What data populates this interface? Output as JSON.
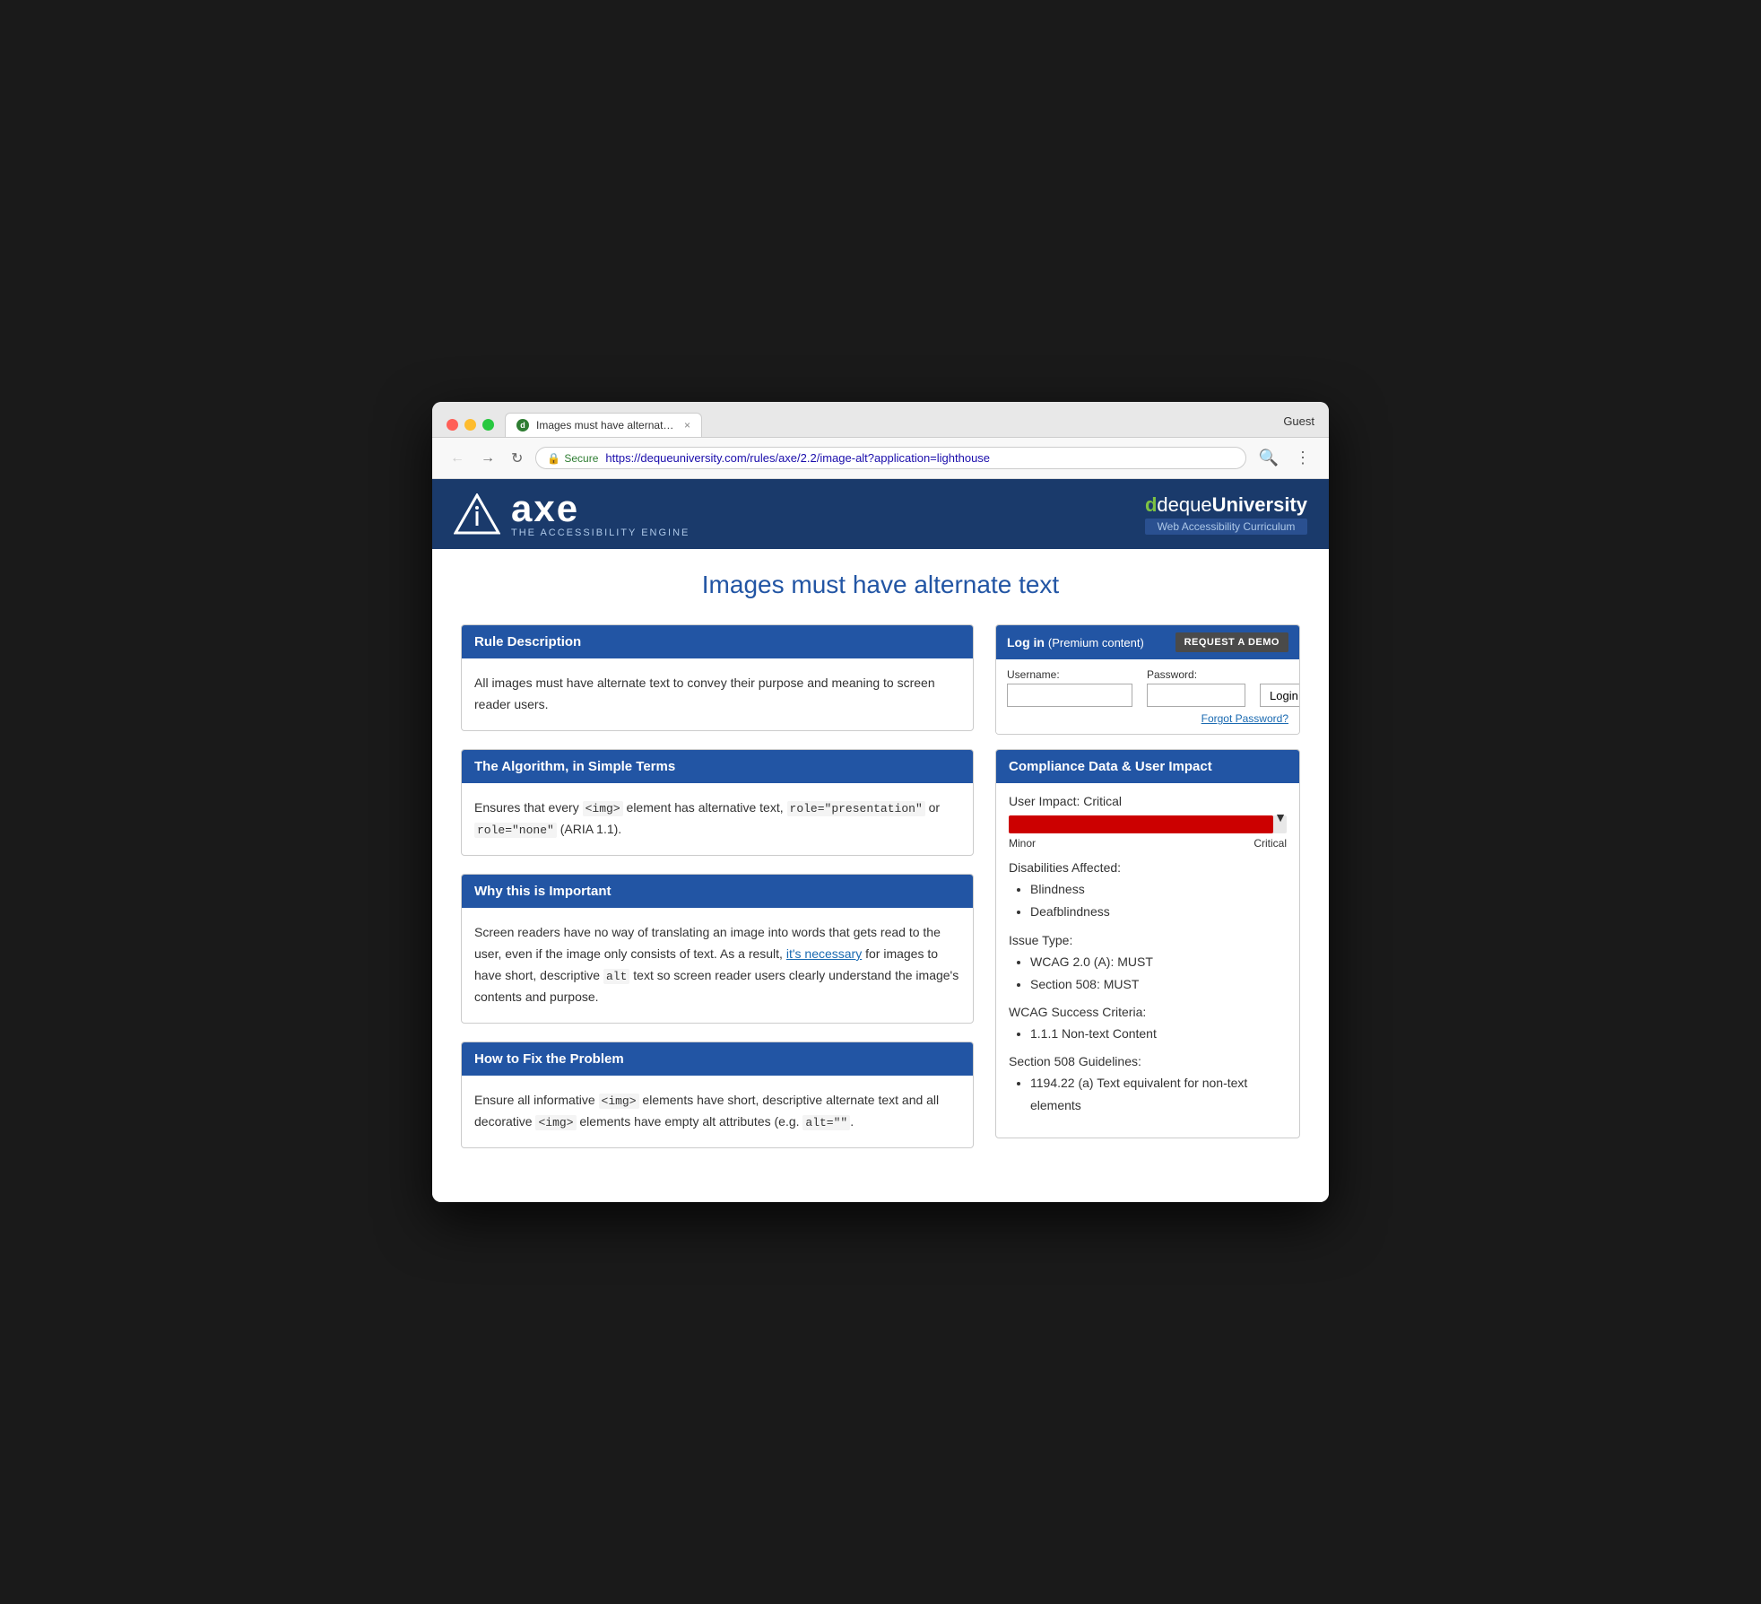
{
  "browser": {
    "tab_title": "Images must have alternate te…",
    "tab_favicon": "d",
    "guest_label": "Guest",
    "url_secure": "Secure",
    "url_full": "https://dequeuniversity.com/rules/axe/2.2/image-alt?application=lighthouse",
    "url_base": "https://dequeuniversity.com",
    "url_path": "/rules/axe/2.2/image-alt?application=lighthouse"
  },
  "header": {
    "axe_brand": "axe",
    "axe_tagline": "THE ACCESSIBILITY ENGINE",
    "deque_prefix": "deque",
    "deque_suffix": "University",
    "deque_subtitle": "Web Accessibility Curriculum"
  },
  "page": {
    "title": "Images must have alternate text"
  },
  "login": {
    "title": "Log in",
    "premium_text": "(Premium content)",
    "request_demo": "REQUEST A DEMO",
    "username_label": "Username:",
    "password_label": "Password:",
    "login_btn": "Login",
    "forgot_link": "Forgot Password?"
  },
  "compliance": {
    "header": "Compliance Data & User Impact",
    "user_impact_label": "User Impact:",
    "user_impact_value": "Critical",
    "scale_min": "Minor",
    "scale_max": "Critical",
    "disabilities_title": "Disabilities Affected:",
    "disabilities": [
      "Blindness",
      "Deafblindness"
    ],
    "issue_type_title": "Issue Type:",
    "issue_types": [
      "WCAG 2.0 (A): MUST",
      "Section 508: MUST"
    ],
    "wcag_title": "WCAG Success Criteria:",
    "wcag_items": [
      "1.1.1 Non-text Content"
    ],
    "section508_title": "Section 508 Guidelines:",
    "section508_items": [
      "1194.22 (a) Text equivalent for non-text elements"
    ]
  },
  "sections": {
    "rule_desc": {
      "header": "Rule Description",
      "body": "All images must have alternate text to convey their purpose and meaning to screen reader users."
    },
    "algorithm": {
      "header": "The Algorithm, in Simple Terms",
      "body_prefix": "Ensures that every ",
      "code1": "<img>",
      "body_middle": " element has alternative text, ",
      "code2": "role=\"presentation\"",
      "body_middle2": " or ",
      "code3": "role=\"none\"",
      "body_suffix": " (ARIA 1.1)."
    },
    "why_important": {
      "header": "Why this is Important",
      "body": "Screen readers have no way of translating an image into words that gets read to the user, even if the image only consists of text. As a result, it's necessary for images to have short, descriptive alt text so screen reader users clearly understand the image's contents and purpose."
    },
    "how_to_fix": {
      "header": "How to Fix the Problem",
      "body_prefix": "Ensure all informative ",
      "code1": "<img>",
      "body_middle": " elements have short, descriptive alternate text and all decorative ",
      "code2": "<img>",
      "body_middle2": " elements have empty alt attributes (e.g. ",
      "code3": "alt=\"\"",
      "body_suffix": "."
    }
  }
}
